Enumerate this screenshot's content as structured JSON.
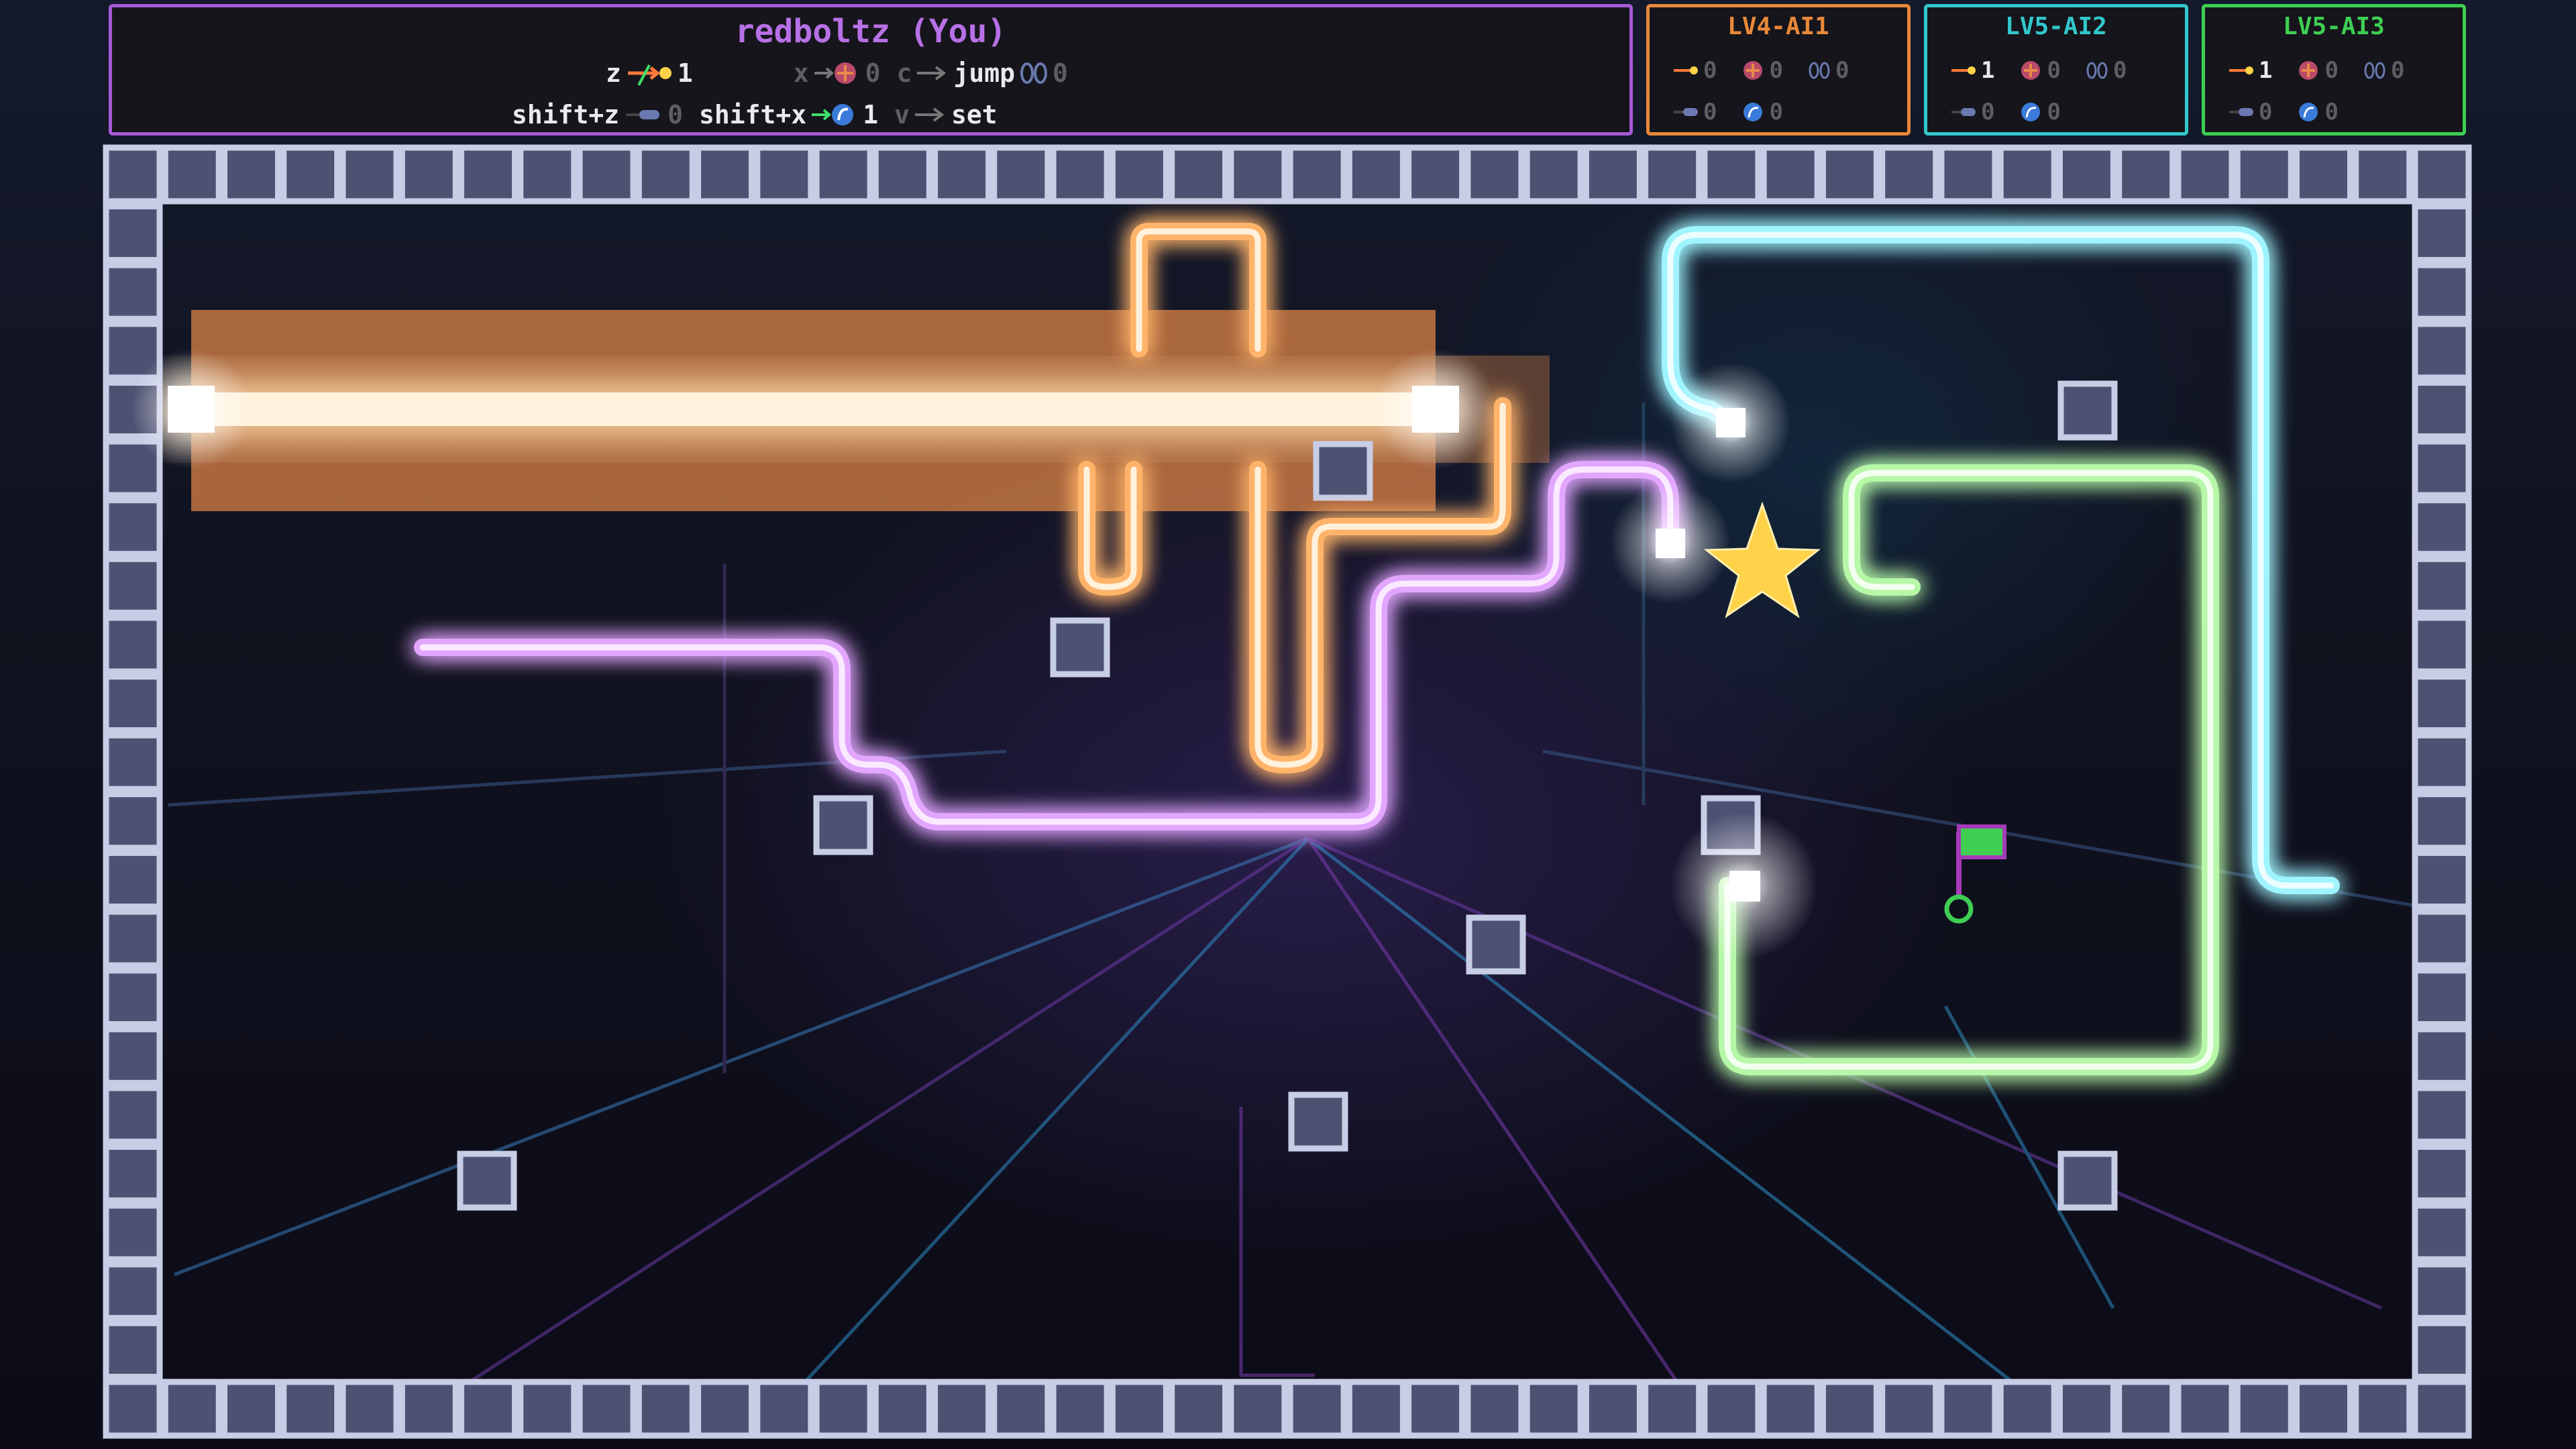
{
  "players": {
    "main": {
      "name": "redboltz (You)",
      "color": "#b770e6",
      "row1": {
        "key_z": "z",
        "count_z": "1",
        "key_x": "x",
        "count_x": "0",
        "key_c": "c",
        "label_jump": "jump",
        "count_jump": "0"
      },
      "row2": {
        "key_shift_z": "shift+z",
        "count_shift_z": "0",
        "key_shift_x": "shift+x",
        "count_shift_x": "1",
        "key_v": "v",
        "label_set": "set"
      }
    },
    "ai1": {
      "name": "LV4-AI1",
      "color": "#e9883a",
      "counts": [
        "0",
        "0",
        "0",
        "0",
        "0"
      ]
    },
    "ai2": {
      "name": "LV5-AI2",
      "color": "#32c8cc",
      "counts": [
        "1",
        "0",
        "0",
        "0",
        "0"
      ]
    },
    "ai3": {
      "name": "LV5-AI3",
      "color": "#3fcf52",
      "counts": [
        "1",
        "0",
        "0",
        "0",
        "0"
      ]
    }
  },
  "icons": [
    "laser-icon",
    "bomb-icon",
    "jump-icon",
    "wall-icon",
    "portal-icon",
    "star-icon",
    "goal-flag-icon"
  ],
  "colors": {
    "orange_line": "#ffb46a",
    "purple_line": "#e2a6ff",
    "cyan_line": "#9ff4ff",
    "green_line": "#b6f7a8",
    "star": "#ffd24a",
    "block": "#c8cde6",
    "flag": "#3fcf52"
  }
}
